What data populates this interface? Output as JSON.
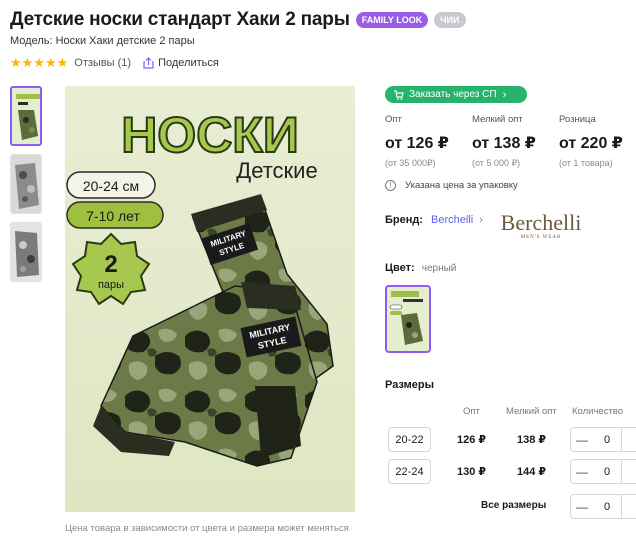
{
  "product": {
    "title": "Детские носки стандарт Хаки 2 пары",
    "badges": [
      "FAMILY LOOK",
      "ЧИИ"
    ],
    "model": "Модель: Носки Хаки детские 2 пары",
    "rating_stars": "★★★★★",
    "rating_value": 5,
    "reviews": "Отзывы (1)",
    "share": "Поделиться"
  },
  "image": {
    "headline": "НОСКИ",
    "subtitle": "Детские",
    "size_label": "20-24 см",
    "age_label": "7-10 лет",
    "pairs_number": "2",
    "pairs_word": "пары",
    "tag_line1": "MILITARY",
    "tag_line2": "STYLE",
    "caption": "Цена товара в зависимости от цвета и размера может меняться"
  },
  "order": {
    "sp_button": "Заказать через СП"
  },
  "prices": [
    {
      "label": "Опт",
      "value": "от 126 ₽",
      "sub": "(от 35 000₽)"
    },
    {
      "label": "Мелкий опт",
      "value": "от 138 ₽",
      "sub": "(от 5 000 ₽)"
    },
    {
      "label": "Розница",
      "value": "от 220 ₽",
      "sub": "(от 1 товара)"
    }
  ],
  "note": "Указана цена за упаковку",
  "brand": {
    "key": "Бренд:",
    "name": "Berchelli",
    "logo_text": "Berchelli",
    "logo_sub": "MEN'S WEAR"
  },
  "color": {
    "key": "Цвет:",
    "value": "черный"
  },
  "sizes": {
    "title": "Размеры",
    "headers": [
      "Опт",
      "Мелкий опт",
      "Количество"
    ],
    "rows": [
      {
        "size": "20-22",
        "opt": "126 ₽",
        "small_opt": "138 ₽",
        "qty": "0"
      },
      {
        "size": "22-24",
        "opt": "130 ₽",
        "small_opt": "144 ₽",
        "qty": "0"
      }
    ],
    "all_sizes_label": "Все размеры",
    "all_qty": "0"
  },
  "colors": {
    "accent_purple": "#8d5cf6",
    "green_button": "#27b36b",
    "star": "#ffb400",
    "link": "#5d5fef"
  }
}
